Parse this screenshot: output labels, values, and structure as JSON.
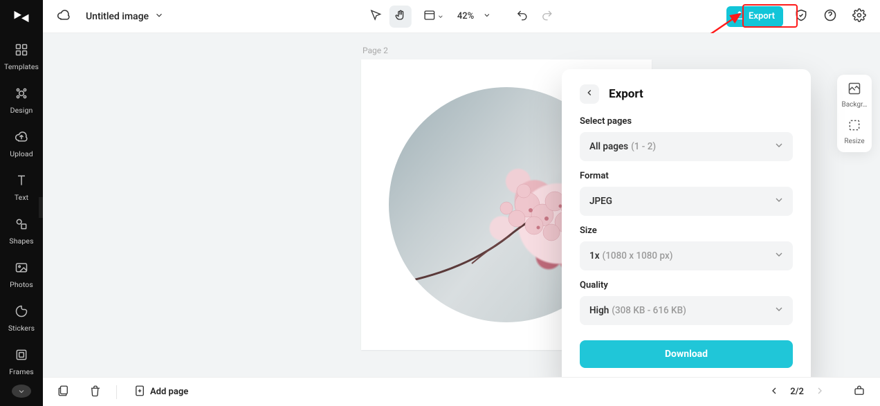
{
  "header": {
    "doc_title": "Untitled image",
    "zoom": "42%"
  },
  "export_button": {
    "label": "Export"
  },
  "left_rail": {
    "items": [
      {
        "label": "Templates"
      },
      {
        "label": "Design"
      },
      {
        "label": "Upload"
      },
      {
        "label": "Text"
      },
      {
        "label": "Shapes"
      },
      {
        "label": "Photos"
      },
      {
        "label": "Stickers"
      },
      {
        "label": "Frames"
      }
    ]
  },
  "right_tools": {
    "items": [
      {
        "label": "Backgr…"
      },
      {
        "label": "Resize"
      }
    ]
  },
  "canvas": {
    "page_label": "Page 2"
  },
  "export_panel": {
    "title": "Export",
    "select_pages": {
      "label": "Select pages",
      "value": "All pages",
      "hint": "(1 - 2)"
    },
    "format": {
      "label": "Format",
      "value": "JPEG"
    },
    "size": {
      "label": "Size",
      "value": "1x",
      "hint": "(1080 x 1080 px)"
    },
    "quality": {
      "label": "Quality",
      "value": "High",
      "hint": "(308 KB - 616 KB)"
    },
    "download": "Download"
  },
  "bottom": {
    "add_page": "Add page",
    "page_counter": "2/2"
  },
  "colors": {
    "accent": "#12c5d8"
  }
}
